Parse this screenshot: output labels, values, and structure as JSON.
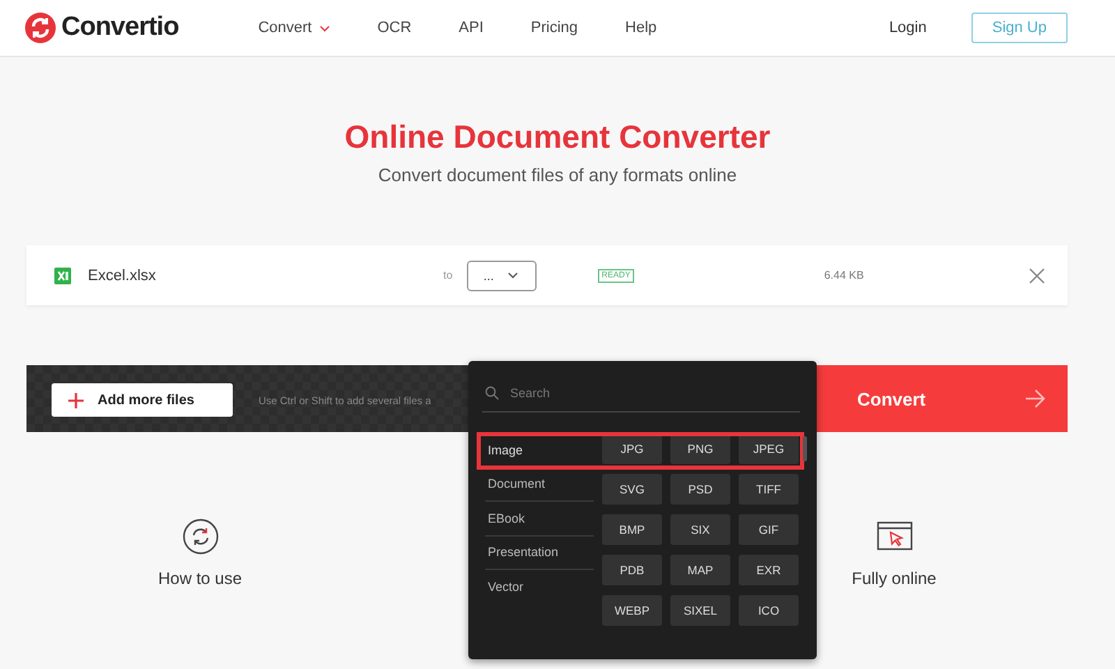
{
  "header": {
    "logo": "Convertio",
    "nav": [
      {
        "label": "Convert",
        "dropdown": true
      },
      {
        "label": "OCR",
        "dropdown": false
      },
      {
        "label": "API",
        "dropdown": false
      },
      {
        "label": "Pricing",
        "dropdown": false
      },
      {
        "label": "Help",
        "dropdown": false
      }
    ],
    "login": "Login",
    "signup": "Sign Up"
  },
  "hero": {
    "title": "Online Document Converter",
    "subtitle": "Convert document files of any formats online"
  },
  "file": {
    "name": "Excel.xlsx",
    "to": "to",
    "format": "...",
    "status": "READY",
    "size": "6.44 KB"
  },
  "actions": {
    "add": "Add more files",
    "hint": "Use Ctrl or Shift to add several files a",
    "convert": "Convert"
  },
  "dropdown": {
    "placeholder": "Search",
    "categories": [
      {
        "label": "Image",
        "selected": true
      },
      {
        "label": "Document",
        "selected": false
      },
      {
        "label": "EBook",
        "selected": false
      },
      {
        "label": "Presentation",
        "selected": false
      },
      {
        "label": "Vector",
        "selected": false
      }
    ],
    "formats": [
      "JPG",
      "PNG",
      "JPEG",
      "SVG",
      "PSD",
      "TIFF",
      "BMP",
      "SIX",
      "GIF",
      "PDB",
      "MAP",
      "EXR",
      "WEBP",
      "SIXEL",
      "ICO"
    ]
  },
  "features": [
    {
      "kind": "sync",
      "label": "How to use"
    },
    {
      "kind": "browser",
      "label": "Fully online"
    }
  ]
}
